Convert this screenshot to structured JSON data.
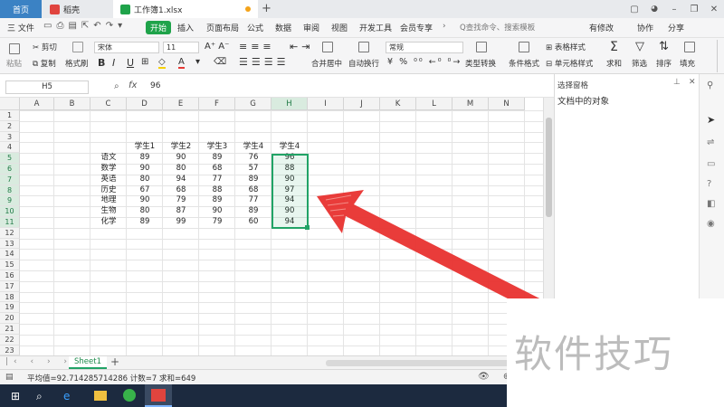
{
  "titlebar": {
    "tabs": [
      {
        "label": "首页"
      },
      {
        "label": "稻壳"
      },
      {
        "label": "工作簿1.xlsx"
      }
    ],
    "new_tab": "+"
  },
  "menubar": {
    "file": "三 文件",
    "items": [
      "开始",
      "插入",
      "页面布局",
      "公式",
      "数据",
      "审阅",
      "视图",
      "开发工具",
      "会员专享"
    ],
    "search_placeholder": "Q查找命令、搜索模板",
    "right": [
      "有修改",
      "协作",
      "分享"
    ]
  },
  "ribbon": {
    "clipboard": {
      "paste": "粘贴",
      "cut": "剪切",
      "copy": "复制",
      "format_painter": "格式刷"
    },
    "font_name": "宋体",
    "font_size": "11",
    "number_format": "常规",
    "merge": "合并居中",
    "wrap": "自动换行",
    "convert": "类型转换",
    "cond_format": "条件格式",
    "table_style": "表格样式",
    "cell_style": "单元格样式",
    "sum": "求和",
    "filter": "筛选",
    "sort": "排序",
    "fill": "填充",
    "fmt_symbols": [
      "B",
      "I",
      "U",
      "A",
      "A"
    ]
  },
  "formula": {
    "namebox": "H5",
    "fx": "fx",
    "value": "96"
  },
  "grid": {
    "columns": [
      "A",
      "B",
      "C",
      "D",
      "E",
      "F",
      "G",
      "H",
      "I",
      "J",
      "K",
      "L",
      "M",
      "N"
    ],
    "rows": [
      "1",
      "2",
      "3",
      "4",
      "5",
      "6",
      "7",
      "8",
      "9",
      "10",
      "11",
      "12",
      "13",
      "14",
      "15",
      "16",
      "17",
      "18",
      "19",
      "20",
      "21",
      "22",
      "23"
    ],
    "headers": [
      "学生1",
      "学生2",
      "学生3",
      "学生4",
      "学生4"
    ],
    "subjects": [
      "语文",
      "数学",
      "英语",
      "历史",
      "地理",
      "生物",
      "化学"
    ],
    "values": [
      [
        "89",
        "90",
        "89",
        "76",
        "96"
      ],
      [
        "90",
        "80",
        "68",
        "57",
        "88"
      ],
      [
        "80",
        "94",
        "77",
        "89",
        "90"
      ],
      [
        "67",
        "68",
        "88",
        "68",
        "97"
      ],
      [
        "90",
        "79",
        "89",
        "77",
        "94"
      ],
      [
        "80",
        "87",
        "90",
        "89",
        "90"
      ],
      [
        "89",
        "99",
        "79",
        "60",
        "94"
      ]
    ]
  },
  "sheets": {
    "active": "Sheet1",
    "add": "+"
  },
  "status": {
    "text": "平均值=92.714285714286  计数=7  求和=649"
  },
  "pane": {
    "title": "选择窗格",
    "subtitle": "文档中的对象"
  },
  "watermark": "软件技巧",
  "colors": {
    "accent_green": "#1fa34a",
    "arrow_red": "#e8312f",
    "selection": "#21a366",
    "taskbar": "#1c2a3f"
  }
}
